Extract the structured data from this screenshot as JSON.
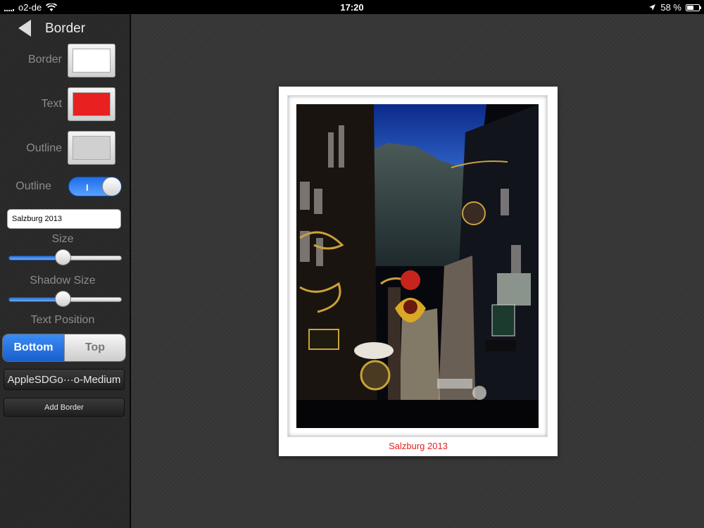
{
  "status_bar": {
    "carrier": "o2-de",
    "time": "17:20",
    "battery": "58 %",
    "battery_level": 0.58
  },
  "nav": {
    "title": "Border"
  },
  "colors": {
    "border_label": "Border",
    "border_color": "#ffffff",
    "text_label": "Text",
    "text_color": "#e82020",
    "outline_label": "Outline",
    "outline_color": "#d0d0d0"
  },
  "outline_toggle": {
    "label": "Outline",
    "on_glyph": "I",
    "state": true
  },
  "caption_input": {
    "value": "Salzburg 2013"
  },
  "size_slider": {
    "label": "Size",
    "value": 0.48
  },
  "shadow_slider": {
    "label": "Shadow Size",
    "value": 0.48
  },
  "text_position": {
    "label": "Text Position",
    "options": [
      "Bottom",
      "Top"
    ],
    "selected": "Bottom"
  },
  "font_button": {
    "label": "AppleSDGo···o-Medium"
  },
  "add_border_button": {
    "label": "Add Border"
  },
  "preview": {
    "caption": "Salzburg 2013"
  }
}
